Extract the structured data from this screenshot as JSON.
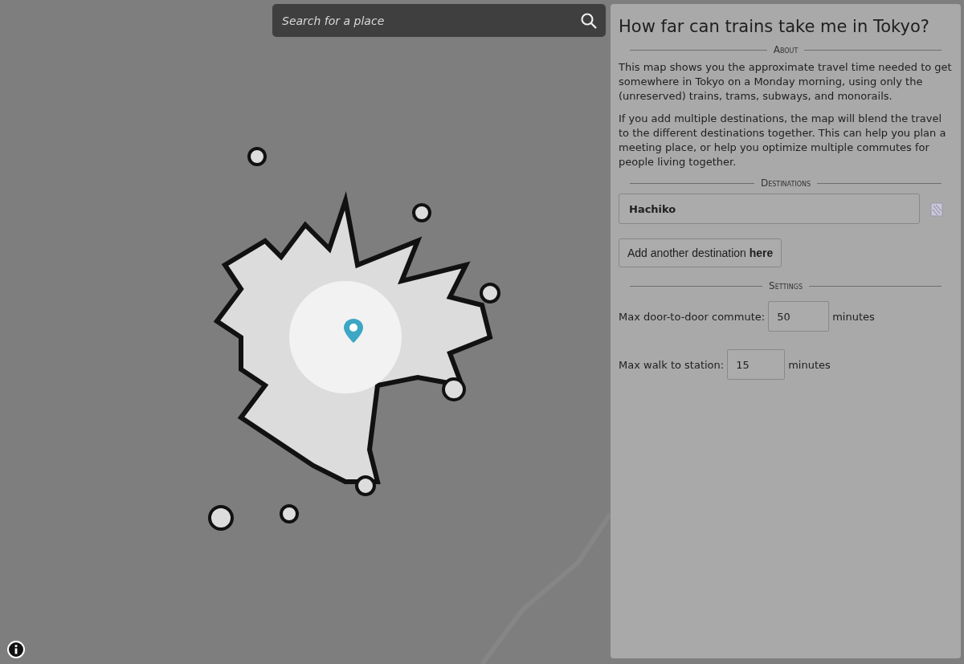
{
  "search": {
    "placeholder": "Search for a place"
  },
  "panel": {
    "title": "How far can trains take me in Tokyo?",
    "about": {
      "heading": "About",
      "paragraphs": [
        "This map shows you the approximate travel time needed to get somewhere in Tokyo on a Monday morning, using only the (unreserved) trains, trams, subways, and monorails.",
        "If you add multiple destinations, the map will blend the travel to the different destinations together. This can help you plan a meeting place, or help you optimize multiple commutes for people living together."
      ]
    },
    "destinations": {
      "heading": "Destinations",
      "items": [
        {
          "value": "Hachiko"
        }
      ],
      "add_button": "Add another destination **here**"
    },
    "settings": {
      "heading": "Settings",
      "fields": [
        {
          "label": "Max door-to-door commute:",
          "value": "50",
          "unit": "minutes"
        },
        {
          "label": "Max walk to station:",
          "value": "15",
          "unit": "minutes"
        }
      ]
    }
  }
}
